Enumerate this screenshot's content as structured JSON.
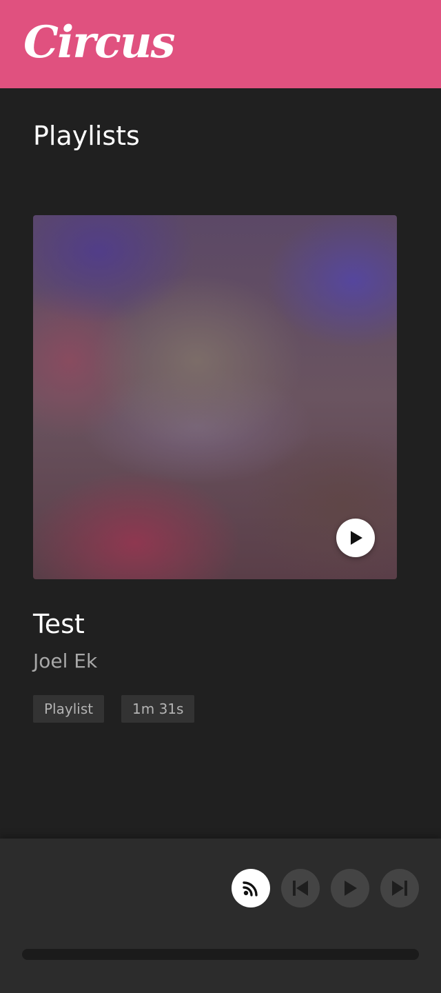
{
  "app": {
    "logo_text": "Circus",
    "brand_color": "#e0517f"
  },
  "page": {
    "title": "Playlists"
  },
  "card": {
    "title": "Test",
    "author": "Joel Ek",
    "tags": {
      "type": "Playlist",
      "duration": "1m 31s"
    },
    "artwork": "blurred-gradient-artwork",
    "play_icon": "play-icon"
  },
  "player": {
    "buttons": [
      {
        "icon": "rss-icon",
        "active": true
      },
      {
        "icon": "skip-previous-icon",
        "active": false
      },
      {
        "icon": "play-icon",
        "active": false
      },
      {
        "icon": "skip-next-icon",
        "active": false
      }
    ],
    "progress": 0
  }
}
